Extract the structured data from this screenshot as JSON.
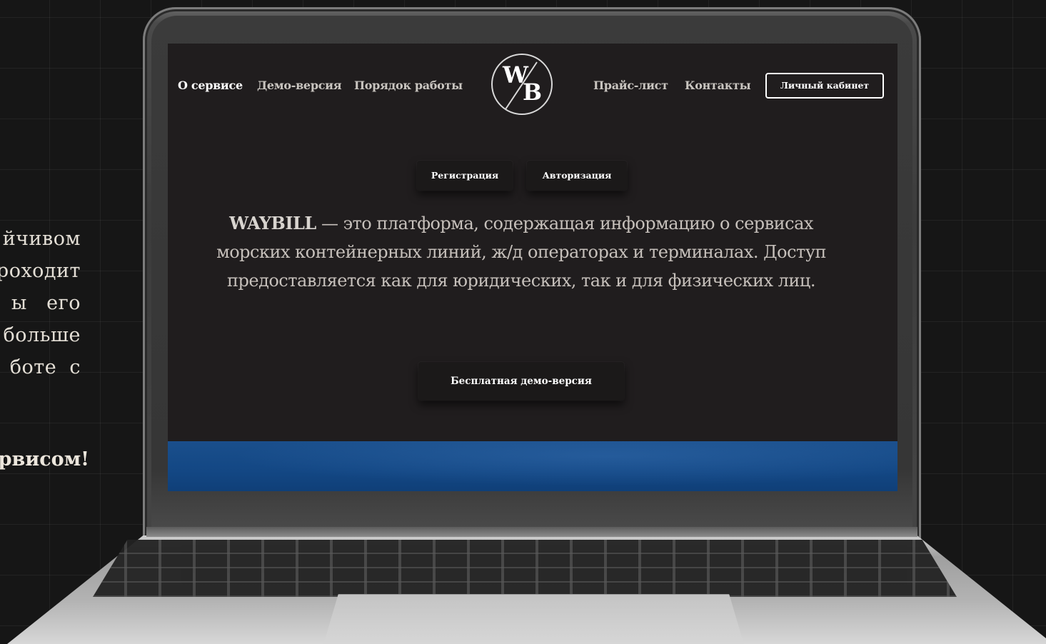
{
  "side_paragraph": {
    "lines": [
      "йчивом",
      "роходит",
      "ы   его",
      "больше",
      "боте  с"
    ],
    "closing": "рвисом!"
  },
  "screen": {
    "nav": {
      "left": [
        "О сервисе",
        "Демо-версия",
        "Порядок работы"
      ],
      "right": [
        "Прайс-лист",
        "Контакты"
      ],
      "cabinet_button": "Личный кабинет"
    },
    "logo": {
      "letter_top": "W",
      "letter_bottom": "B",
      "icon": "waybill-logo-icon"
    },
    "auth_buttons": {
      "register": "Регистрация",
      "login": "Авторизация"
    },
    "hero": {
      "brand": "WAYBILL",
      "text_1": " — это платформа, содержащая информацию о сервисах морских контейнерных линий, ж/д операторах и терминалах.",
      "text_2": "Доступ предоставляется как для юридических, так и для физических лиц."
    },
    "demo_button": "Бесплатная демо-версия"
  },
  "colors": {
    "page_bg": "#161616",
    "screen_bg": "#201d1e",
    "accent_blue": "#134784",
    "text": "#c6c0bb"
  }
}
